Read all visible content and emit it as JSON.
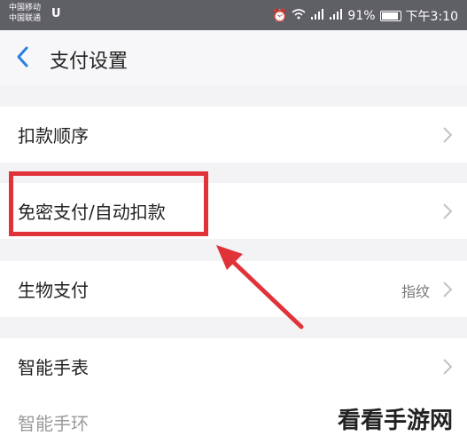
{
  "status_bar": {
    "carrier1": "中国移动",
    "carrier2": "中国联通",
    "usb_icon": "usb-icon",
    "signal1": "⁴ᴳ",
    "signal2": "⁴ᴳ",
    "battery_percent": "91%",
    "time": "下午3:10"
  },
  "header": {
    "title": "支付设置",
    "back_icon": "back-arrow-icon"
  },
  "settings": [
    {
      "label": "扣款顺序"
    },
    {
      "label": "免密支付/自动扣款"
    },
    {
      "label": "生物支付",
      "value": "指纹"
    },
    {
      "label": "智能手表"
    },
    {
      "label": "智能手环"
    }
  ],
  "annotation": {
    "highlight_color": "#e03339"
  },
  "watermark": "看看手游网"
}
